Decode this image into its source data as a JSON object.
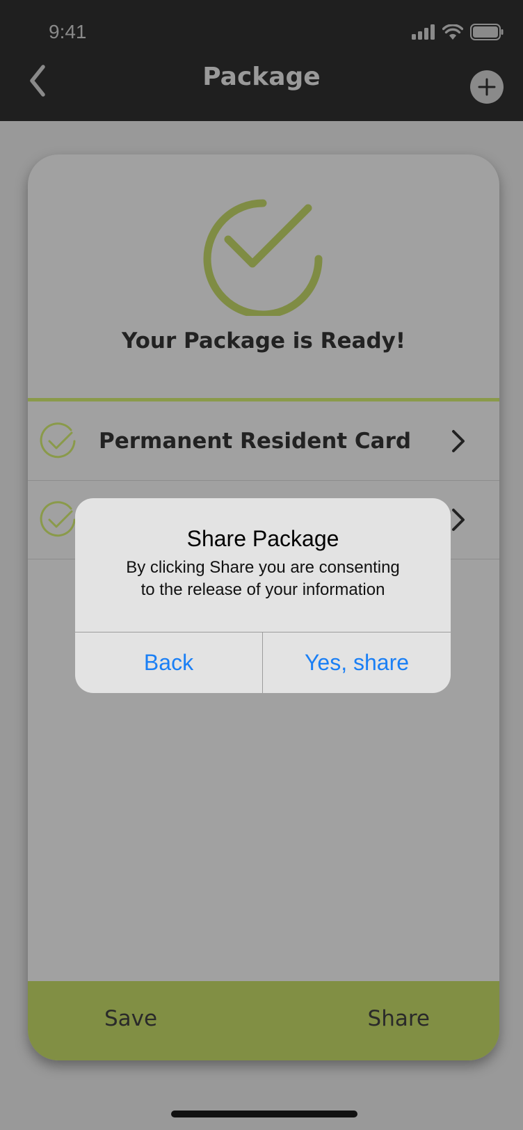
{
  "status_bar": {
    "time": "9:41"
  },
  "header": {
    "title": "Package",
    "back_icon": "chevron-left-icon",
    "add_icon": "plus-icon"
  },
  "card": {
    "headline": "Your Package is Ready!",
    "documents": [
      {
        "label": "Permanent Resident Card"
      },
      {
        "label": ""
      }
    ],
    "save_label": "Save",
    "share_label": "Share"
  },
  "alert": {
    "title": "Share Package",
    "message_line1": "By clicking Share you are consenting",
    "message_line2": "to the release of your information",
    "back_label": "Back",
    "confirm_label": "Yes, share"
  },
  "colors": {
    "accent_green": "#8a9a4a",
    "bottom_bar": "#818f44",
    "link_blue": "#1a7ff5",
    "header_bg": "#1f1f1f"
  }
}
